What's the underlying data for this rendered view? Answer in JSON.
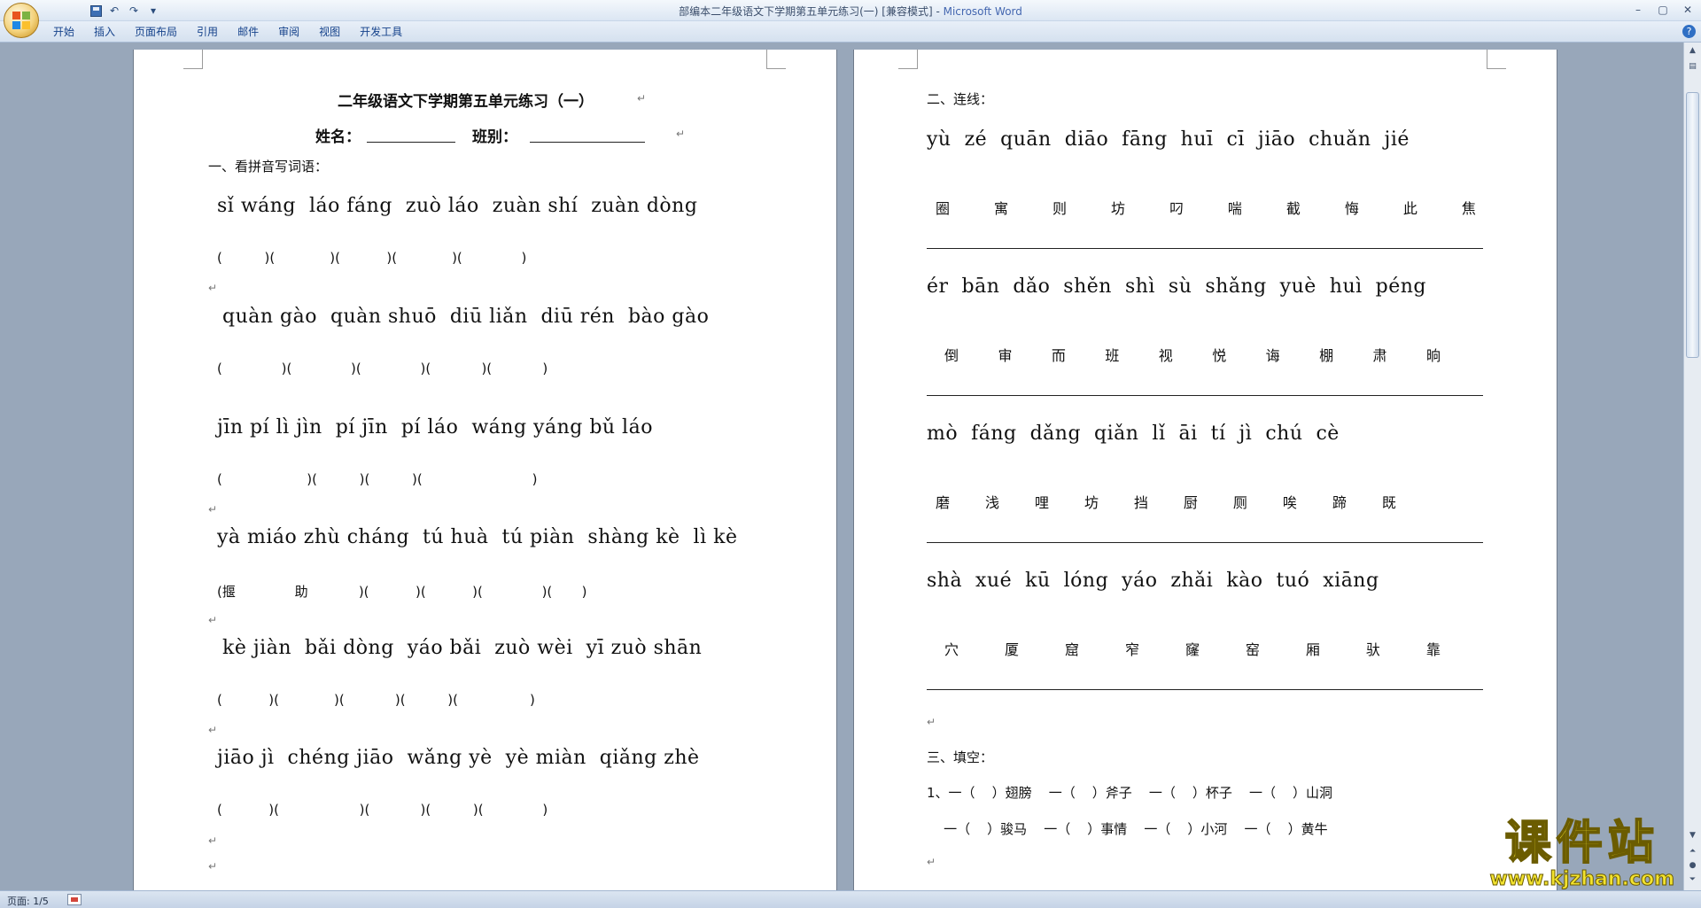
{
  "window": {
    "title": "部编本二年级语文下学期第五单元练习(一) [兼容模式] - ",
    "app_name": "Microsoft Word"
  },
  "ribbon": {
    "tabs": [
      "开始",
      "插入",
      "页面布局",
      "引用",
      "邮件",
      "审阅",
      "视图",
      "开发工具"
    ]
  },
  "qat": {
    "save": "save-icon",
    "undo": "↶",
    "redo": "↷",
    "customize": "▾"
  },
  "window_controls": {
    "minimize": "–",
    "maximize": "▢",
    "close": "✕"
  },
  "page1": {
    "title": "二年级语文下学期第五单元练习（一）",
    "name_label": "姓名：",
    "class_label": "班别：",
    "section1": "一、看拼音写词语：",
    "pinyin_rows": [
      "sǐ wáng  láo fáng  zuò láo  zuàn shí  zuàn dòng",
      "quàn gào  quàn shuō  diū liǎn  diū rén  bào gào",
      "jīn pí lì jìn  pí jīn  pí láo  wáng yáng bǔ láo",
      "yà miáo zhù cháng  tú huà  tú piàn  shàng kè  lì kè",
      "kè jiàn  bǎi dòng  yáo bǎi  zuò wèi  yī zuò shān",
      "jiāo jì  chéng jiāo  wǎng yè  yè miàn  qiǎng zhè"
    ],
    "paren_rows": [
      "(          )(             )(           )(             )(              )",
      "(              )(              )(              )(            )(            )",
      "(                    )(          )(          )(                          )",
      "(揠              助            )(           )(           )(              )(       )",
      "(           )(             )(            )(          )(                 )",
      "(           )(                   )(            )(          )(              )"
    ]
  },
  "page2": {
    "section2": "二、连线：",
    "pinyin_rows": [
      "yù  zé  quān  diāo  fāng  huī  cī  jiāo  chuǎn  jié",
      "ér  bān  dǎo  shěn  shì  sù  shǎng  yuè  huì  péng",
      "mò  fáng  dǎng  qiǎn  lǐ  āi  tí  jì  chú  cè",
      "shà  xué  kū  lóng  yáo  zhǎi  kào  tuó  xiāng"
    ],
    "char_rows": [
      [
        "圈",
        "寓",
        "则",
        "坊",
        "叼",
        "喘",
        "截",
        "悔",
        "此",
        "焦"
      ],
      [
        "倒",
        "审",
        "而",
        "班",
        "视",
        "悦",
        "诲",
        "棚",
        "肃",
        "晌"
      ],
      [
        "磨",
        "浅",
        "哩",
        "坊",
        "挡",
        "厨",
        "厕",
        "唉",
        "蹄",
        "既"
      ],
      [
        "穴",
        "厦",
        "窟",
        "窄",
        "窿",
        "窑",
        "厢",
        "驮",
        "靠"
      ]
    ],
    "section3": "三、填空：",
    "fill_rows": [
      "1、一（    ）翅膀    一（    ）斧子    一（    ）杯子    一（    ）山洞",
      "    一（    ）骏马    一（    ）事情    一（    ）小河    一（    ）黄牛"
    ]
  },
  "status": {
    "page": "页面: 1/5"
  },
  "watermark": {
    "text": "课件站",
    "url": "www.kjzhan.com"
  }
}
